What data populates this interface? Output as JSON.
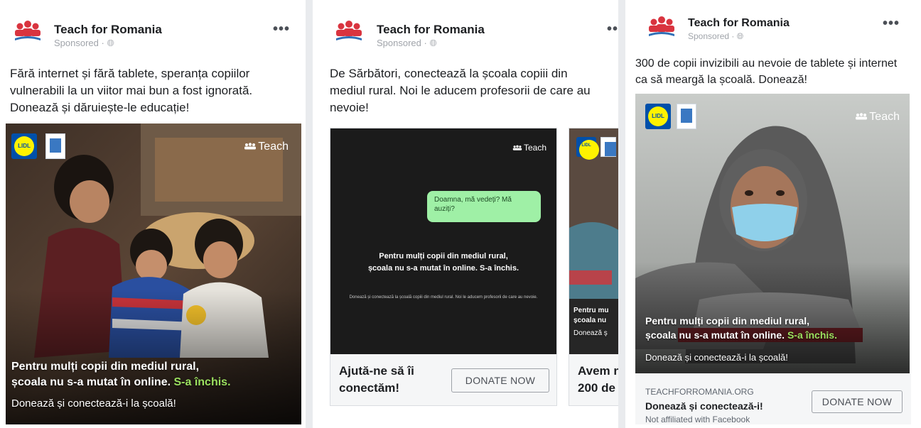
{
  "colors": {
    "accent_green": "#9be05f",
    "lidl_blue": "#0050aa",
    "lidl_yellow": "#fff200"
  },
  "icons": [
    "teach-for-romania-logo-icon",
    "globe-icon",
    "more-options-icon",
    "lidl-logo-icon"
  ],
  "post1": {
    "page_name": "Teach for Romania",
    "sponsored": "Sponsored · ",
    "privacy_icon": "🌐︎",
    "more": "•••",
    "caption": "Fără internet și fără tablete, speranța copiilor vulnerabili la un viitor mai bun a fost ignorată. Donează și dăruiește-le educație!",
    "image": {
      "lidl": "LIDL",
      "teach": "Teach",
      "headline_1": "Pentru mulți copii din mediul rural,",
      "headline_2a": "școala nu s-a mutat în online. ",
      "headline_2b": "S-a închis.",
      "subline": "Donează și conectează-i la școală!"
    }
  },
  "post2": {
    "page_name": "Teach for Romania",
    "sponsored": "Sponsored · ",
    "privacy_icon": "🌐︎",
    "more": "•••",
    "caption": "De Sărbători, conectează la școala copiii din mediul rural. Noi le aducem profesorii de care au nevoie!",
    "card1": {
      "teach": "Teach",
      "bubble": "Doamna, mă vedeți? Mă auziți?",
      "headline_1": "Pentru mulți copii din mediul rural,",
      "headline_2": "școala nu s-a mutat în online. S-a închis.",
      "small_text": "Donează și conectează la școală copiii din mediul rural. Noi le aducem profesorii de care au nevoie.",
      "title": "Ajută-ne să îi conectăm!",
      "button": "DONATE NOW"
    },
    "card2": {
      "lidl": "LIDL",
      "overlay_1": "Pentru mu",
      "overlay_2": "școala nu",
      "overlay_3": "Donează ș",
      "title_1": "Avem n",
      "title_2": "200 de"
    }
  },
  "post3": {
    "page_name": "Teach for Romania",
    "sponsored": "Sponsored · ",
    "privacy_icon": "🌐︎",
    "more": "•••",
    "caption": "300 de copii invizibili au nevoie de tablete și internet ca să meargă la școală. Donează!",
    "image": {
      "lidl": "LIDL",
      "teach": "Teach",
      "headline_1": "Pentru mulți copii din mediul rural,",
      "headline_2a": "școala nu s-a mutat în online. ",
      "headline_2b": "S-a închis.",
      "subline": "Donează și conectează-i la școală!"
    },
    "link": {
      "domain": "TEACHFORROMANIA.ORG",
      "title": "Donează și conectează-i!",
      "affiliation": "Not affiliated with Facebook",
      "button": "DONATE NOW"
    }
  }
}
